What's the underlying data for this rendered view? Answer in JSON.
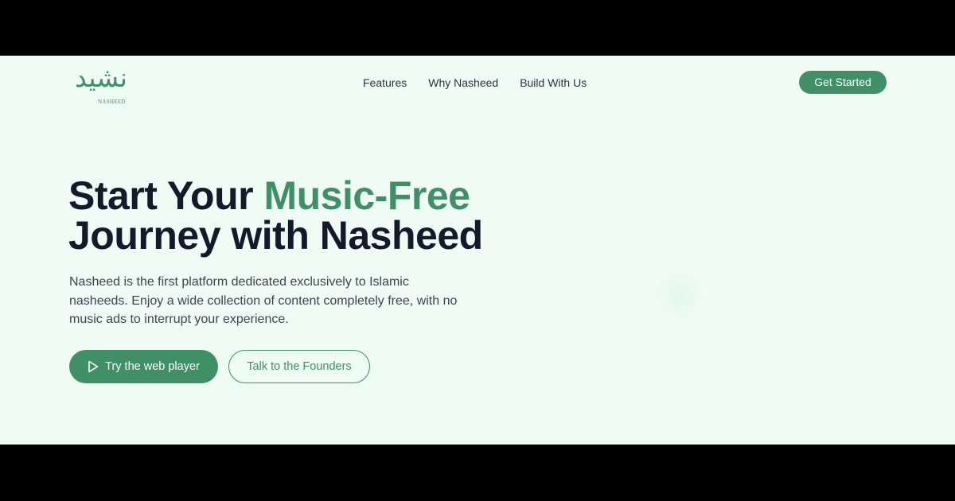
{
  "brand": {
    "logo_arabic": "نشيد",
    "logo_text": "NASHEED"
  },
  "nav": {
    "items": [
      "Features",
      "Why Nasheed",
      "Build With Us"
    ],
    "cta_label": "Get Started"
  },
  "hero": {
    "headline_part1": "Start Your ",
    "headline_accent": "Music-Free",
    "headline_part2": "Journey with Nasheed",
    "description": "Nasheed is the first platform dedicated exclusively to Islamic nasheeds. Enjoy a wide collection of content completely free, with no music ads to interrupt your experience.",
    "primary_button": "Try the web player",
    "secondary_button": "Talk to the Founders"
  },
  "colors": {
    "accent": "#3f8f67",
    "background": "#effcf5",
    "heading": "#131b2a",
    "frame": "#000000"
  },
  "icons": {
    "primary_button_icon": "play-icon"
  }
}
